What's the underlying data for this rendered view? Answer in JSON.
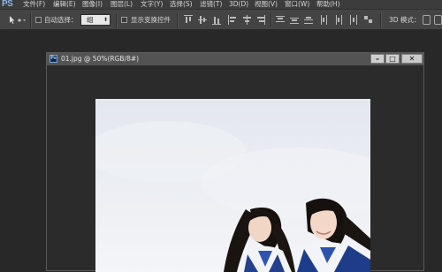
{
  "app": {
    "logo": "PS"
  },
  "menu": [
    {
      "label": "文件(F)"
    },
    {
      "label": "编辑(E)"
    },
    {
      "label": "图像(I)"
    },
    {
      "label": "图层(L)"
    },
    {
      "label": "文字(Y)"
    },
    {
      "label": "选择(S)"
    },
    {
      "label": "滤镜(T)"
    },
    {
      "label": "3D(D)"
    },
    {
      "label": "视图(V)"
    },
    {
      "label": "窗口(W)"
    },
    {
      "label": "帮助(H)"
    }
  ],
  "options": {
    "auto_select_label": "自动选择：",
    "auto_select_checked": false,
    "auto_select_value": "组",
    "show_transform_label": "显示变换控件",
    "show_transform_checked": false,
    "mode_3d_label": "3D 模式："
  },
  "document": {
    "icon": "Ps",
    "title": "01.jpg @ 50%(RGB/8#)",
    "minimize": "–",
    "restore": "□",
    "close": "✕"
  }
}
